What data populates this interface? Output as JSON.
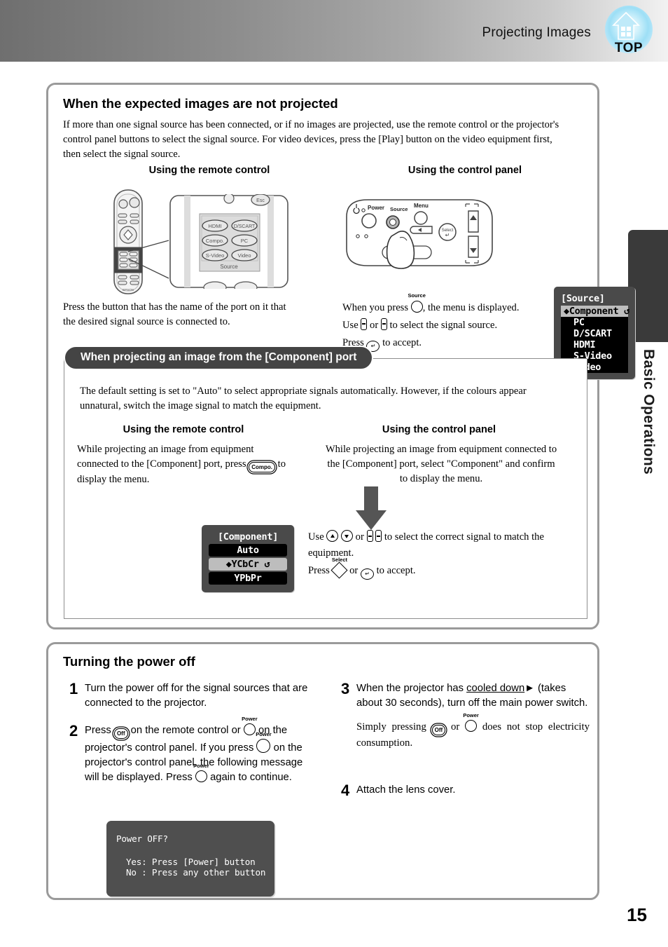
{
  "header": {
    "title": "Projecting Images",
    "top_badge_label": "TOP"
  },
  "side_tab": {
    "label": "Basic Operations"
  },
  "page_number": "15",
  "section_sources": {
    "heading": "When the expected images are not projected",
    "intro": "If more than one signal source has been connected, or if no images are projected, use the remote control or the projector's control panel buttons to select the signal source. For video devices, press the [Play] button on the video equipment first, then select the signal source.",
    "col_left_head": "Using the remote control",
    "col_right_head": "Using the control panel",
    "remote_buttons": [
      "HDMI",
      "D/SCART",
      "Compo.",
      "PC",
      "S-Video",
      "Video"
    ],
    "remote_group_label": "Source",
    "remote_esc_label": "Esc",
    "remote_brand": "EPSON",
    "panel_labels": {
      "power": "Power",
      "source": "Source",
      "menu": "Menu",
      "select": "Select"
    },
    "osd_source": {
      "title": "[Source]",
      "items": [
        "Component",
        "PC",
        "D/SCART",
        "HDMI",
        "S-Video",
        "Video"
      ],
      "selected_index": 0
    },
    "caption_left": "Press the button that has the name of the port on it that the desired signal source is connected to.",
    "caption_right": {
      "line1_a": "When you press",
      "line1_b": ", the menu is displayed.",
      "line2_a": "Use",
      "line2_b": "or",
      "line2_c": "to select the signal source.",
      "line3_a": "Press",
      "line3_b": "to accept.",
      "source_label": "Source"
    }
  },
  "section_component": {
    "tab_title": "When projecting an image from the [Component] port",
    "intro": "The default setting is set to \"Auto\" to select appropriate signals automatically. However, if the colours appear unnatural, switch the image signal to match the equipment.",
    "col_left_head": "Using the remote control",
    "col_right_head": "Using the control panel",
    "left_text_a": "While projecting an image from equipment connected to the [Component] port, press",
    "left_button_label": "Compo.",
    "left_text_b": "to display the menu.",
    "right_text": "While projecting an image from equipment connected to the [Component] port, select \"Component\" and confirm to display the menu.",
    "osd_component": {
      "title": "[Component]",
      "items": [
        "Auto",
        "YCbCr",
        "YPbPr"
      ],
      "selected_index": 1
    },
    "instructions": {
      "line1_a": "Use",
      "line1_b": "or",
      "line1_c": "to select the correct signal to match the equipment.",
      "line2_a": "Press",
      "line2_b": "or",
      "line2_c": "to accept.",
      "select_label": "Select"
    }
  },
  "section_poweroff": {
    "heading": "Turning the power off",
    "steps": [
      {
        "num": "1",
        "text": "Turn the power off for the signal sources that are connected to the projector."
      },
      {
        "num": "2",
        "t1": "Press",
        "t2": "on the remote control or",
        "t3": "on the projector's control panel. If you press",
        "t4": "on the projector's control panel, the following message will be displayed.",
        "t5": "Press",
        "t6": "again to continue.",
        "off_label": "Off",
        "power_label": "Power"
      },
      {
        "num": "3",
        "t1": "When the projector has",
        "link": "cooled down",
        "t2": "(takes about 30 seconds), turn off the main power switch.",
        "note_a": "Simply  pressing",
        "note_b": "or",
        "note_c": "does  not  stop electricity consumption.",
        "off_label": "Off",
        "power_label": "Power"
      },
      {
        "num": "4",
        "text": "Attach the lens cover."
      }
    ],
    "dialog": {
      "line1": "Power OFF?",
      "line2": "Yes: Press [Power] button",
      "line3": "No : Press any other button"
    }
  },
  "colors": {
    "osd_background": "#4a4a4a",
    "osd_selected": "#bdbdbd",
    "tab_dark": "#3a3a3a",
    "panel_border": "#9a9a9a",
    "badge_blue": "#9ddff6"
  }
}
